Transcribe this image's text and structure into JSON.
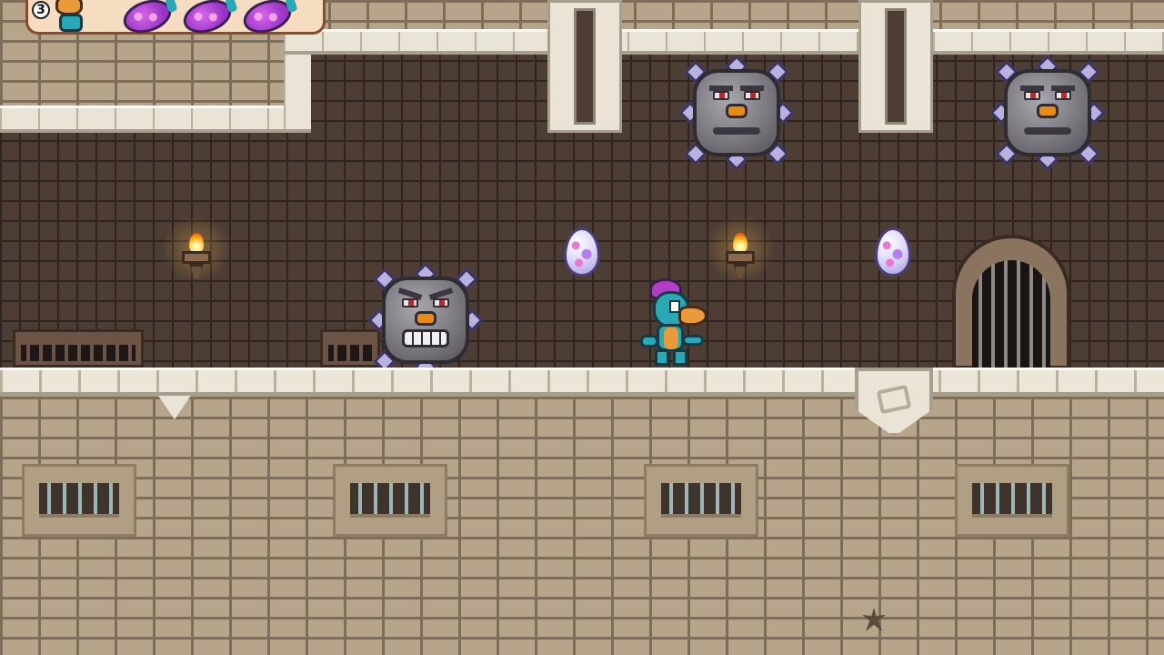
{
  "game": {
    "lives": "3",
    "eggs_collected": 3,
    "colors": {
      "hud_panel": "#f6dcc0",
      "player_body": "#2aa8b6",
      "player_crest": "#b33ec6",
      "egg": "#d566e8",
      "enemy_stone": "#78757d"
    }
  },
  "icons": {
    "lives_icon": "dino-head-icon",
    "egg_icon": "egg-icon",
    "torch_icon": "torch-icon",
    "gate_icon": "portcullis-icon",
    "enemy_icon": "spiked-stone-face-icon"
  }
}
